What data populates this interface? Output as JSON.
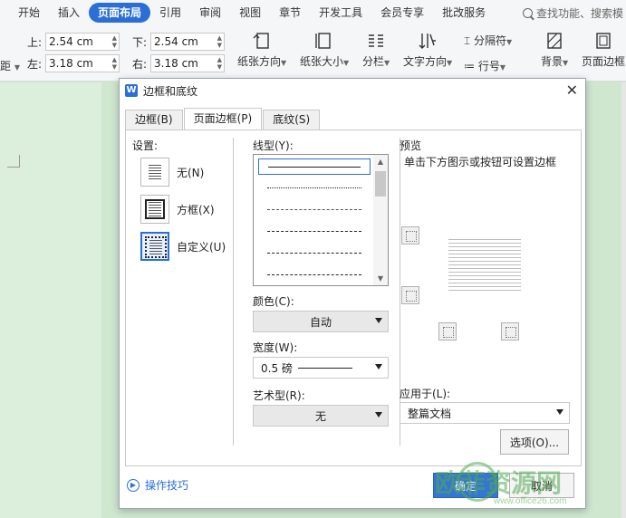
{
  "menubar": {
    "tabs": [
      "开始",
      "插入",
      "页面布局",
      "引用",
      "审阅",
      "视图",
      "章节",
      "开发工具",
      "会员专享",
      "批改服务"
    ],
    "search": "查找功能、搜索模"
  },
  "toolbar": {
    "margin_top_label": "上:",
    "margin_top": "2.54 cm",
    "margin_bottom_label": "下:",
    "margin_bottom": "2.54 cm",
    "margin_left_label": "左:",
    "margin_left": "3.18 cm",
    "margin_right_label": "右:",
    "margin_right": "3.18 cm",
    "margins_label": "距",
    "orientation": "纸张方向",
    "size": "纸张大小",
    "columns": "分栏",
    "text_direction": "文字方向",
    "separator": "分隔符",
    "line_numbers": "行号",
    "background": "背景",
    "page_border": "页面边框"
  },
  "dialog": {
    "title": "边框和底纹",
    "tabs": [
      "边框(B)",
      "页面边框(P)",
      "底纹(S)"
    ],
    "settings_label": "设置:",
    "settings": [
      "无(N)",
      "方框(X)",
      "自定义(U)"
    ],
    "line_style_label": "线型(Y):",
    "color_label": "颜色(C):",
    "color_value": "自动",
    "width_label": "宽度(W):",
    "width_value": "0.5 磅",
    "art_label": "艺术型(R):",
    "art_value": "无",
    "preview_label": "预览",
    "preview_hint": "单击下方图示或按钮可设置边框",
    "apply_label": "应用于(L):",
    "apply_value": "整篇文档",
    "options_button": "选项(O)...",
    "tips_link": "操作技巧",
    "ok_button": "确定",
    "cancel_button": "取消"
  },
  "watermark": {
    "text": "欧菲资源网",
    "url": "www.office26.com"
  },
  "colors": {
    "accent": "#2b6fd6",
    "doc_bg": "#cfe6cf"
  }
}
